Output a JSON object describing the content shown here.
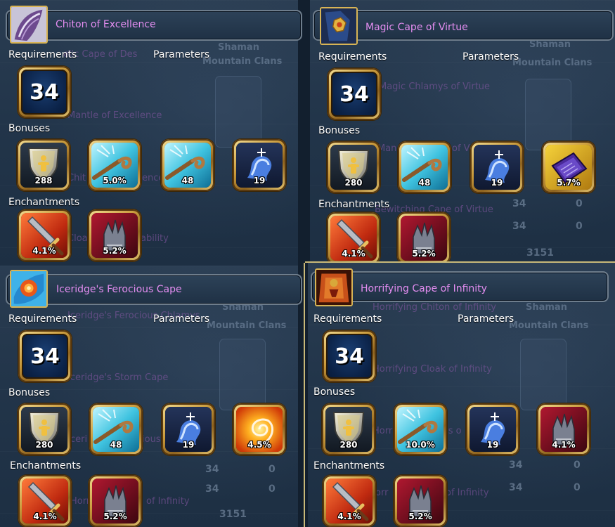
{
  "panels": [
    {
      "title": "Chiton of Excellence",
      "requirements_label": "Requirements",
      "parameters_label": "Parameters",
      "level": "34",
      "bonuses_label": "Bonuses",
      "bonuses": [
        {
          "icon": "armor-shield-icon",
          "value": "288"
        },
        {
          "icon": "energy-staff-icon",
          "value": "5.0%"
        },
        {
          "icon": "energy-staff-icon",
          "value": "48"
        },
        {
          "icon": "water-scroll-icon",
          "value": "19"
        }
      ],
      "enchantments_label": "Enchantments",
      "enchantments": [
        {
          "icon": "sword-icon",
          "value": "4.1%"
        },
        {
          "icon": "claw-glove-icon",
          "value": "5.2%"
        }
      ]
    },
    {
      "title": "Magic Cape of Virtue",
      "requirements_label": "Requirements",
      "parameters_label": "Parameters",
      "level": "34",
      "bonuses_label": "Bonuses",
      "bonuses": [
        {
          "icon": "armor-shield-icon",
          "value": "280"
        },
        {
          "icon": "energy-staff-icon",
          "value": "48"
        },
        {
          "icon": "water-scroll-icon",
          "value": "19"
        },
        {
          "icon": "spellbook-icon",
          "value": "5.7%"
        }
      ],
      "enchantments_label": "Enchantments",
      "enchantments": [
        {
          "icon": "sword-icon",
          "value": "4.1%"
        },
        {
          "icon": "claw-glove-icon",
          "value": "5.2%"
        }
      ]
    },
    {
      "title": "Iceridge's Ferocious Cape",
      "requirements_label": "Requirements",
      "parameters_label": "Parameters",
      "level": "34",
      "bonuses_label": "Bonuses",
      "bonuses": [
        {
          "icon": "armor-shield-icon",
          "value": "280"
        },
        {
          "icon": "energy-staff-icon",
          "value": "48"
        },
        {
          "icon": "water-scroll-icon",
          "value": "19"
        },
        {
          "icon": "fire-vortex-icon",
          "value": "4.5%"
        }
      ],
      "enchantments_label": "Enchantments",
      "enchantments": [
        {
          "icon": "sword-icon",
          "value": "4.1%"
        },
        {
          "icon": "claw-glove-icon",
          "value": "5.2%"
        }
      ]
    },
    {
      "title": "Horrifying Cape of Infinity",
      "requirements_label": "Requirements",
      "parameters_label": "Parameters",
      "level": "34",
      "bonuses_label": "Bonuses",
      "bonuses": [
        {
          "icon": "armor-shield-icon",
          "value": "280"
        },
        {
          "icon": "energy-staff-icon",
          "value": "10.0%"
        },
        {
          "icon": "water-scroll-icon",
          "value": "19"
        },
        {
          "icon": "claw-glove-icon",
          "value": "4.1%"
        }
      ],
      "enchantments_label": "Enchantments",
      "enchantments": [
        {
          "icon": "sword-icon",
          "value": "4.1%"
        },
        {
          "icon": "claw-glove-icon",
          "value": "5.2%"
        }
      ]
    }
  ],
  "background": {
    "p0": [
      "elic Cape of Des",
      "Mantle of Excellence",
      "Chit",
      "ence",
      "Cloa",
      "ability",
      "Shaman",
      "Mountain Clans"
    ],
    "p1": [
      "Magic Chlamys of Virtue",
      "Man",
      "of V",
      "Bewitching Cape of Virtue",
      "Shaman",
      "Mountain Clans",
      "34",
      "0",
      "34",
      "0",
      "3151"
    ],
    "p2": [
      "Iceridge's Ferocious Chlamys",
      "Iceridge's Storm Cape",
      "ceri",
      "ious",
      "Horr",
      "of Infinity",
      "Shaman",
      "Mountain Clans",
      "34",
      "0",
      "34",
      "0",
      "3151"
    ],
    "p3": [
      "Horrifying Chiton of Infinity",
      "Horrifying Cloak of Infinity",
      "Horr",
      "ys o",
      "orr",
      "of Infinity",
      "Shaman",
      "Mountain Clans",
      "34",
      "0",
      "34",
      "0"
    ]
  }
}
